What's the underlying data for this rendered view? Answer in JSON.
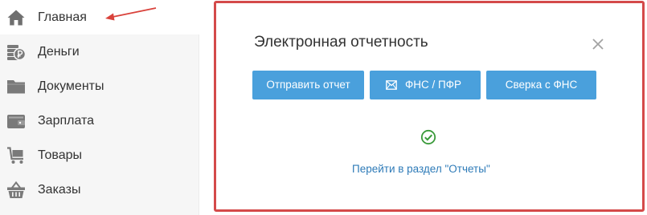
{
  "sidebar": {
    "items": [
      {
        "label": "Главная",
        "icon": "home-icon",
        "active": true
      },
      {
        "label": "Деньги",
        "icon": "money-icon",
        "active": false
      },
      {
        "label": "Документы",
        "icon": "folder-icon",
        "active": false
      },
      {
        "label": "Зарплата",
        "icon": "wallet-icon",
        "active": false
      },
      {
        "label": "Товары",
        "icon": "cart-icon",
        "active": false
      },
      {
        "label": "Заказы",
        "icon": "basket-icon",
        "active": false
      }
    ]
  },
  "modal": {
    "title": "Электронная отчетность",
    "buttons": {
      "send": "Отправить отчет",
      "fns": "ФНС / ПФР",
      "sverka": "Сверка с ФНС"
    },
    "status_icon": "check-circle-icon",
    "link": "Перейти в раздел \"Отчеты\""
  },
  "colors": {
    "sidebar_bg": "#f6f6f6",
    "icon_gray": "#7a7a7a",
    "button_blue": "#4aa0dc",
    "link_blue": "#2e7bb8",
    "highlight_red": "#d44a4a",
    "check_green": "#3a9a3a"
  }
}
